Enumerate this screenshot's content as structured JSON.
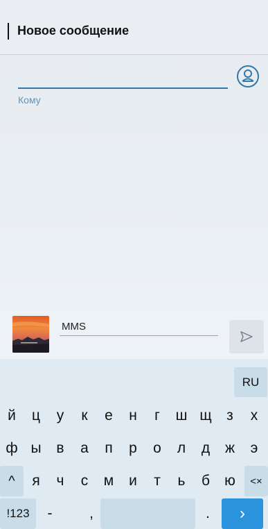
{
  "header": {
    "title": "Новое сообщение"
  },
  "recipient": {
    "label": "Кому",
    "contact_icon": "contact-person-icon"
  },
  "compose": {
    "attachment_icon": "image-thumbnail",
    "mms_label": "MMS",
    "send_icon": "send-icon"
  },
  "keyboard": {
    "lang_label": "RU",
    "row1": [
      "й",
      "ц",
      "у",
      "к",
      "е",
      "н",
      "г",
      "ш",
      "щ",
      "з",
      "х"
    ],
    "row2": [
      "ф",
      "ы",
      "в",
      "а",
      "п",
      "р",
      "о",
      "л",
      "д",
      "ж",
      "э"
    ],
    "row3": [
      "я",
      "ч",
      "с",
      "м",
      "и",
      "т",
      "ь",
      "б",
      "ю"
    ],
    "shift_symbol": "^",
    "backspace_symbol": "<×",
    "numbers_label": "!123",
    "dash_label": "-",
    "comma_label": ",",
    "period_label": ".",
    "enter_symbol": "›"
  },
  "colors": {
    "accent": "#2f78a8",
    "enter_key": "#2b93dd",
    "keyboard_bg": "#dfeaf2",
    "fn_key": "#c9dde8"
  }
}
